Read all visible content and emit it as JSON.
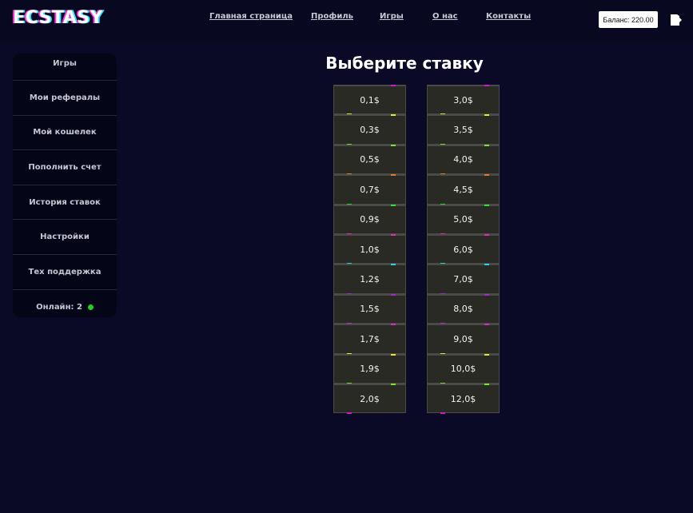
{
  "header": {
    "logo": "ECSTASY",
    "nav": [
      {
        "label": "Главная страница"
      },
      {
        "label": "Профиль"
      },
      {
        "label": "Игры"
      },
      {
        "label": "О нас"
      },
      {
        "label": "Контакты"
      }
    ],
    "balance": "Баланс: 220.00",
    "logout_icon": "logout-icon"
  },
  "sidebar": {
    "items": [
      {
        "label": "Игры"
      },
      {
        "label": "Мои рефералы"
      },
      {
        "label": "Мой кошелек"
      },
      {
        "label": "Пополнить счет"
      },
      {
        "label": "История ставок"
      },
      {
        "label": "Настройки"
      },
      {
        "label": "Тех поддержка"
      }
    ],
    "online_label": "Онлайн: 2",
    "online_color": "#1fd21f"
  },
  "main": {
    "title": "Выберите ставку",
    "bets_left": [
      "0,1$",
      "0,3$",
      "0,5$",
      "0,7$",
      "0,9$",
      "1,0$",
      "1,2$",
      "1,5$",
      "1,7$",
      "1,9$",
      "2,0$"
    ],
    "bets_right": [
      "3,0$",
      "3,5$",
      "4,0$",
      "4,5$",
      "5,0$",
      "6,0$",
      "7,0$",
      "8,0$",
      "9,0$",
      "10,0$",
      "12,0$"
    ],
    "accent_colors": [
      "#d21ad2",
      "#e6e62a",
      "#7ae62a",
      "#e6782a",
      "#2ae62a",
      "#e62ab4",
      "#2ad2e6",
      "#a02ad2",
      "#d22ad2",
      "#e6e62a",
      "#7ae62a"
    ]
  }
}
